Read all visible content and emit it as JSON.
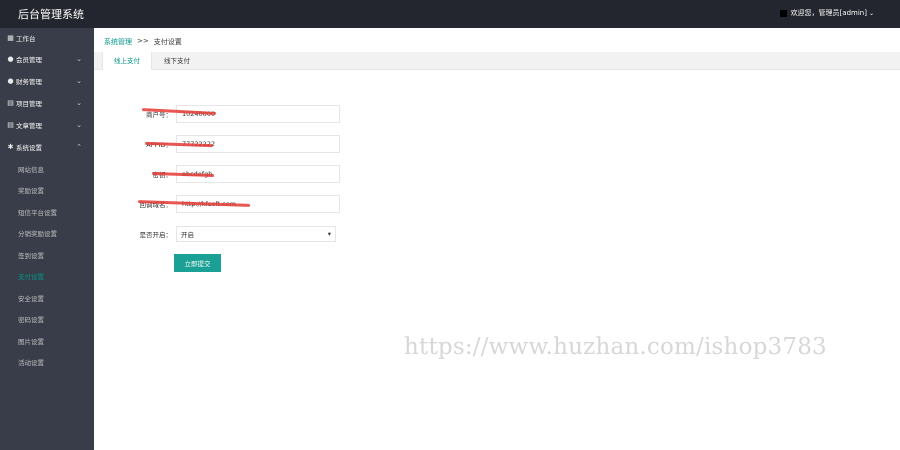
{
  "app": {
    "title": "后台管理系统"
  },
  "user": {
    "greeting": "欢迎您，管理员[admin]"
  },
  "sidebar": {
    "items": [
      {
        "label": "工作台",
        "icon": "dashboard-icon"
      },
      {
        "label": "会员管理",
        "icon": "member-icon"
      },
      {
        "label": "财务管理",
        "icon": "finance-icon"
      },
      {
        "label": "项目管理",
        "icon": "project-icon"
      },
      {
        "label": "文章管理",
        "icon": "article-icon"
      },
      {
        "label": "系统设置",
        "icon": "settings-icon"
      }
    ],
    "sub_items": [
      {
        "label": "网站信息"
      },
      {
        "label": "奖励设置"
      },
      {
        "label": "短信平台设置"
      },
      {
        "label": "分销奖励设置"
      },
      {
        "label": "签到设置"
      },
      {
        "label": "支付设置"
      },
      {
        "label": "安全设置"
      },
      {
        "label": "密码设置"
      },
      {
        "label": "图片设置"
      },
      {
        "label": "活动设置"
      }
    ]
  },
  "breadcrumb": {
    "parent": "系统管理",
    "separator": ">>",
    "current": "支付设置"
  },
  "tabs": [
    {
      "label": "线上支付"
    },
    {
      "label": "线下支付"
    }
  ],
  "form": {
    "fields": [
      {
        "label": "商户号：",
        "value": "10240000"
      },
      {
        "label": "APPID：",
        "value": "77722222"
      },
      {
        "label": "密钥：",
        "value": "abcdefgh"
      },
      {
        "label": "回调域名：",
        "value": "http://kfsoft.com"
      }
    ],
    "open_label": "是否开启：",
    "open_value": "开启",
    "submit_label": "立即提交"
  },
  "watermark": {
    "text": "https://www.huzhan.com/ishop3783"
  },
  "colors": {
    "accent": "#009688",
    "sidebar_bg": "#393d49",
    "topbar_bg": "#23262e",
    "button": "#1aa094"
  }
}
